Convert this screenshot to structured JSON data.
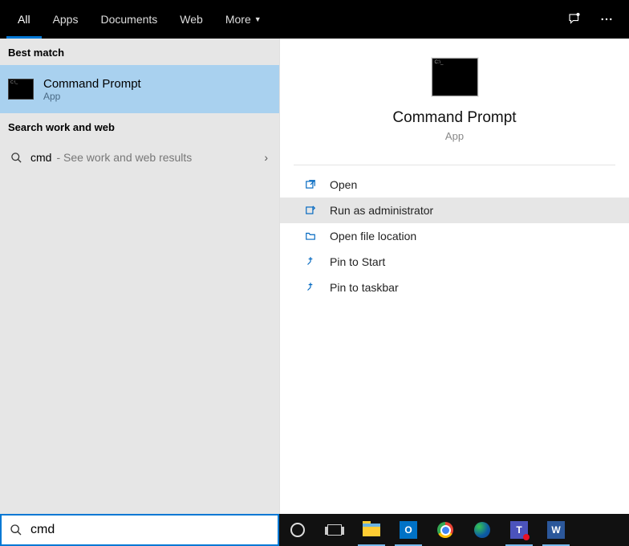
{
  "tabs": {
    "items": [
      {
        "label": "All",
        "active": true
      },
      {
        "label": "Apps",
        "active": false
      },
      {
        "label": "Documents",
        "active": false
      },
      {
        "label": "Web",
        "active": false
      },
      {
        "label": "More",
        "active": false,
        "dropdown": true
      }
    ]
  },
  "left": {
    "best_match_header": "Best match",
    "best_match": {
      "title": "Command Prompt",
      "subtitle": "App"
    },
    "work_web_header": "Search work and web",
    "web_result": {
      "query": "cmd",
      "desc": "- See work and web results"
    }
  },
  "preview": {
    "title": "Command Prompt",
    "subtitle": "App",
    "actions": [
      {
        "label": "Open",
        "icon": "open",
        "hover": false
      },
      {
        "label": "Run as administrator",
        "icon": "admin",
        "hover": true
      },
      {
        "label": "Open file location",
        "icon": "folder",
        "hover": false
      },
      {
        "label": "Pin to Start",
        "icon": "pin",
        "hover": false
      },
      {
        "label": "Pin to taskbar",
        "icon": "pin",
        "hover": false
      }
    ]
  },
  "search": {
    "value": "cmd"
  },
  "taskbar": {
    "items": [
      "cortana",
      "taskview",
      "explorer",
      "outlook",
      "chrome",
      "edge",
      "teams",
      "word"
    ]
  }
}
